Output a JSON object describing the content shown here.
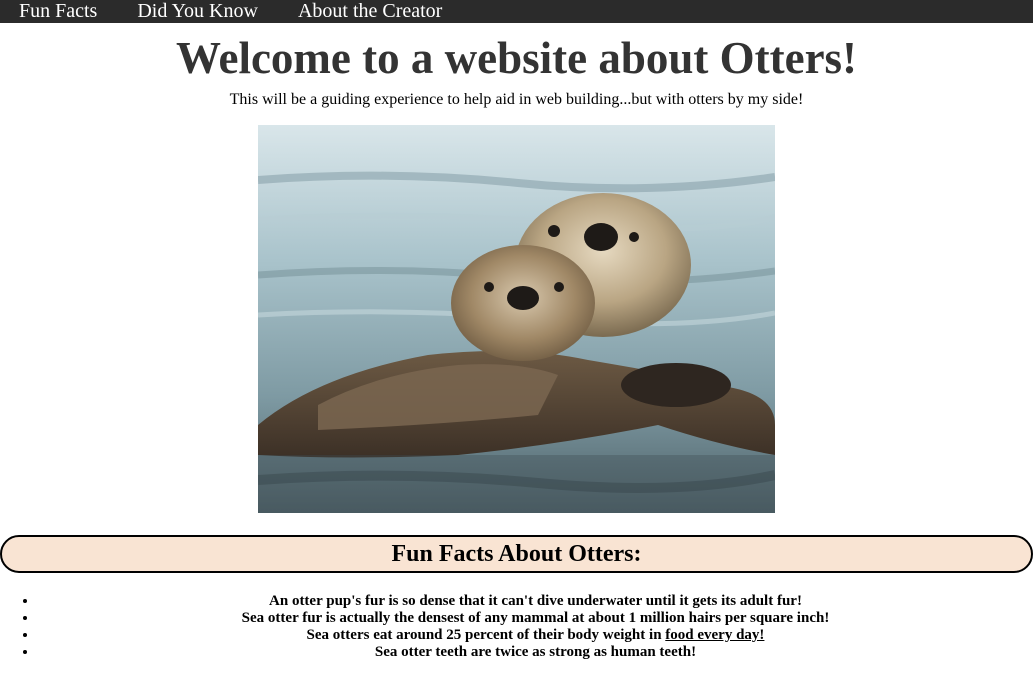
{
  "nav": {
    "items": [
      {
        "label": "Fun Facts"
      },
      {
        "label": "Did You Know"
      },
      {
        "label": "About the Creator"
      }
    ]
  },
  "hero": {
    "title": "Welcome to a website about Otters!",
    "subtitle": "This will be a guiding experience to help aid in web building...but with otters by my side!"
  },
  "image": {
    "alt": "Two sea otters floating in water"
  },
  "facts": {
    "heading": "Fun Facts About Otters:",
    "items": [
      "An otter pup's fur is so dense that it can't dive underwater until it gets its adult fur!",
      "Sea otter fur is actually the densest of any mammal at about 1 million hairs per square inch!",
      "Sea otters eat around 25 percent of their body weight in ",
      "Sea otter teeth are twice as strong as human teeth!"
    ],
    "link_text": "food every day!"
  },
  "colors": {
    "nav_bg": "#2b2b2b",
    "banner_bg": "#f9e4d3",
    "title_color": "#333333"
  }
}
